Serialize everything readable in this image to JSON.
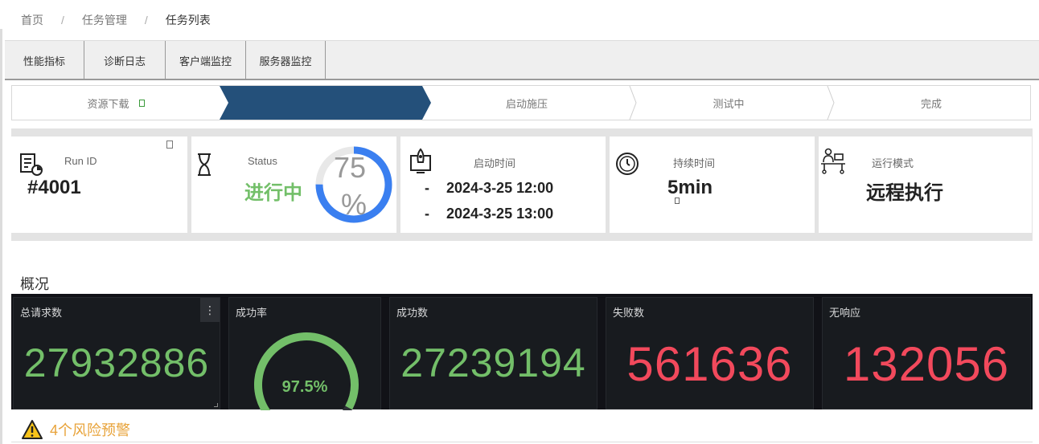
{
  "breadcrumb": {
    "home": "首页",
    "level2": "任务管理",
    "current": "任务列表",
    "sep": "/"
  },
  "tabs": [
    "性能指标",
    "诊断日志",
    "客户端监控",
    "服务器监控"
  ],
  "steps": [
    {
      "label": "资源下载",
      "state": "done"
    },
    {
      "label": "",
      "state": "active"
    },
    {
      "label": "启动施压",
      "state": "pending"
    },
    {
      "label": "测试中",
      "state": "pending"
    },
    {
      "label": "完成",
      "state": "pending"
    }
  ],
  "step_colors": {
    "active": "#24507a",
    "done_check": "#3a9a3a"
  },
  "run": {
    "label": "Run ID",
    "value": "#4001",
    "icon": "report-icon"
  },
  "status": {
    "label": "Status",
    "value": "进行中",
    "progress_pct": 75,
    "progress_text": "75",
    "progress_unit": "%",
    "icon": "hourglass-icon"
  },
  "start_time": {
    "label": "启动时间",
    "dash": "-",
    "start": "2024-3-25 12:00",
    "end": "2024-3-25 13:00",
    "icon": "rocket-icon"
  },
  "duration": {
    "label": "持续时间",
    "value": "5min",
    "icon": "timer-icon"
  },
  "mode": {
    "label": "运行模式",
    "value": "远程执行",
    "icon": "remote-desk-icon"
  },
  "overview": {
    "title": "概况"
  },
  "stats": {
    "total": {
      "label": "总请求数",
      "value": "27932886"
    },
    "success_rate": {
      "label": "成功率",
      "value": "97.5%",
      "gauge_pct": 97.5
    },
    "success": {
      "label": "成功数",
      "value": "27239194"
    },
    "failure": {
      "label": "失败数",
      "value": "561636"
    },
    "no_response": {
      "label": "无响应",
      "value": "132056"
    }
  },
  "colors": {
    "green": "#73bf69",
    "red": "#f2495c",
    "progress_blue": "#3a7ff0",
    "warning": "#e8a33a"
  },
  "warning": {
    "text": "4个风险预警",
    "icon": "warning-triangle-icon"
  }
}
